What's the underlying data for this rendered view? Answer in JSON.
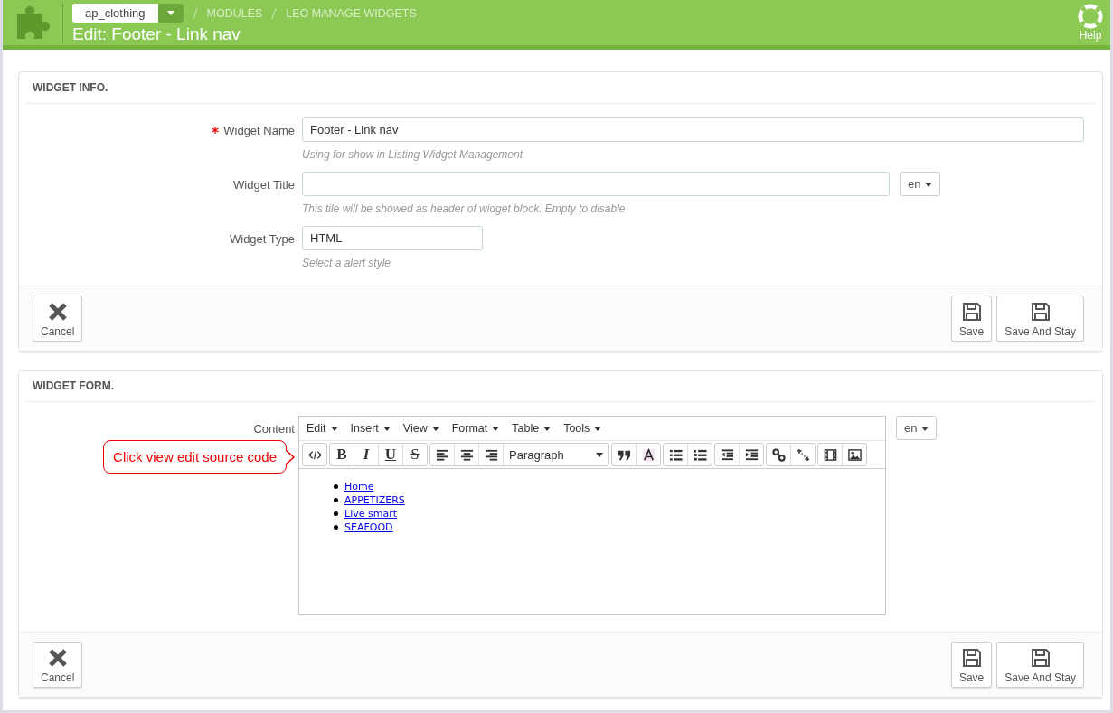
{
  "header": {
    "store": "ap_clothing",
    "breadcrumb": [
      "MODULES",
      "LEO MANAGE WIDGETS"
    ],
    "title": "Edit: Footer - Link nav",
    "help": "Help"
  },
  "info_panel": {
    "heading": "WIDGET INFO.",
    "fields": [
      {
        "label": "Widget Name",
        "required": true,
        "value": "Footer - Link nav",
        "hint": "Using for show in Listing Widget Management",
        "kind": "wide"
      },
      {
        "label": "Widget Title",
        "required": false,
        "hint": "This tile will be showed as header of widget block. Empty to disable",
        "kind": "localized",
        "lang": "en"
      },
      {
        "label": "Widget Type",
        "required": false,
        "value": "HTML",
        "hint": "Select a alert style",
        "kind": "short"
      }
    ],
    "buttons": {
      "cancel": "Cancel",
      "save": "Save",
      "save_stay": "Save And Stay"
    }
  },
  "form_panel": {
    "heading": "WIDGET FORM.",
    "label": "Content",
    "lang": "en",
    "callout": "Click view edit source code",
    "menus": [
      "Edit",
      "Insert",
      "View",
      "Format",
      "Table",
      "Tools"
    ],
    "toolbar": [
      [
        {
          "kind": "code"
        }
      ],
      [
        {
          "kind": "bold",
          "label": "B"
        },
        {
          "kind": "italic",
          "label": "I"
        },
        {
          "kind": "underline",
          "label": "U"
        },
        {
          "kind": "strike",
          "label": "S"
        }
      ],
      [
        {
          "kind": "align-left"
        },
        {
          "kind": "align-center"
        },
        {
          "kind": "align-right"
        },
        {
          "kind": "select",
          "label": "Paragraph"
        }
      ],
      [
        {
          "kind": "quote"
        },
        {
          "kind": "text-color"
        }
      ],
      [
        {
          "kind": "bullet-list"
        },
        {
          "kind": "number-list"
        }
      ],
      [
        {
          "kind": "outdent"
        },
        {
          "kind": "indent"
        }
      ],
      [
        {
          "kind": "link"
        },
        {
          "kind": "unlink"
        }
      ],
      [
        {
          "kind": "media"
        },
        {
          "kind": "image"
        }
      ]
    ],
    "links": [
      "Home",
      "APPETIZERS",
      "Live smart",
      "SEAFOOD"
    ],
    "buttons": {
      "cancel": "Cancel",
      "save": "Save",
      "save_stay": "Save And Stay"
    }
  }
}
